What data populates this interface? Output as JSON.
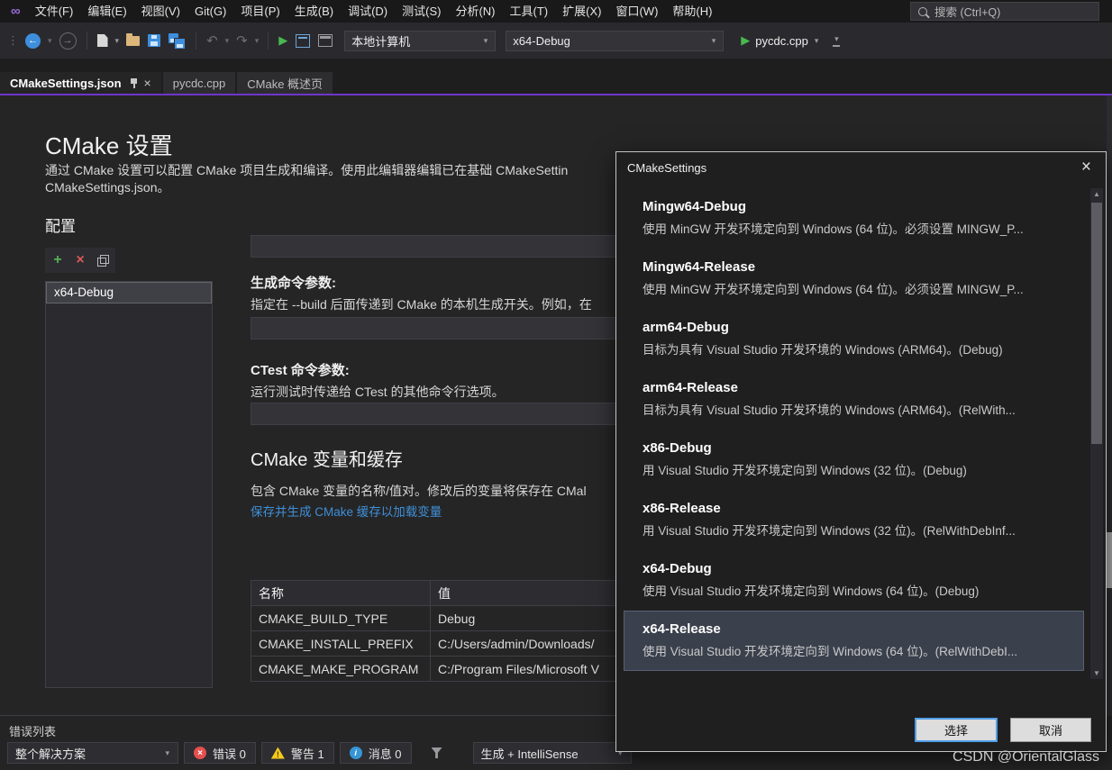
{
  "colors": {
    "accent_purple": "#6d36c9",
    "link_blue": "#3f8fd6",
    "run_green": "#49b94f",
    "error_red": "#e5504f",
    "warning_yellow": "#f2cb1d",
    "info_blue": "#3795d6",
    "editor_background": "#252526"
  },
  "icons": {
    "vs_logo": "infinity-glyph",
    "search": "magnifier",
    "back": "blue-circle-left-arrow",
    "forward": "gray-circle-right-arrow",
    "new_file": "document",
    "open_folder": "yellow-folder",
    "save": "blue-floppy",
    "save_all": "double-blue-floppy",
    "undo": "curved-left-arrow",
    "redo": "curved-right-arrow",
    "run": "green-play-triangle",
    "pin": "pushpin",
    "close": "x",
    "add": "green-plus",
    "remove": "red-x",
    "duplicate": "overlapping-squares",
    "error": "red-circle-x",
    "warning": "yellow-triangle-exclamation",
    "message": "blue-circle-i",
    "filter": "funnel",
    "dropdown_caret": "down-triangle",
    "scroll_up": "up-triangle",
    "scroll_down": "down-triangle"
  },
  "menu": {
    "items": [
      "文件(F)",
      "编辑(E)",
      "视图(V)",
      "Git(G)",
      "项目(P)",
      "生成(B)",
      "调试(D)",
      "测试(S)",
      "分析(N)",
      "工具(T)",
      "扩展(X)",
      "窗口(W)",
      "帮助(H)"
    ],
    "search_placeholder": "搜索 (Ctrl+Q)"
  },
  "toolbar": {
    "target_dropdown": "本地计算机",
    "config_dropdown": "x64-Debug",
    "startup_item": "pycdc.cpp"
  },
  "tabs": [
    {
      "label": "CMakeSettings.json",
      "active": true
    },
    {
      "label": "pycdc.cpp",
      "active": false
    },
    {
      "label": "CMake 概述页",
      "active": false
    }
  ],
  "editor": {
    "title": "CMake 设置",
    "description_line1": "通过 CMake 设置可以配置 CMake 项目生成和编译。使用此编辑器编辑已在基础 CMakeSettin",
    "description_line2": "CMakeSettings.json。",
    "config_section": {
      "title": "配置",
      "items": [
        "x64-Debug"
      ]
    },
    "cmake_args": {
      "value": ""
    },
    "build_args": {
      "label": "生成命令参数:",
      "description": "指定在 --build 后面传递到 CMake 的本机生成开关。例如，在",
      "value": ""
    },
    "ctest_args": {
      "label": "CTest 命令参数:",
      "description": "运行测试时传递给 CTest 的其他命令行选项。",
      "value": ""
    },
    "variables": {
      "title": "CMake 变量和缓存",
      "description": "包含 CMake 变量的名称/值对。修改后的变量将保存在 CMal",
      "link": "保存并生成 CMake 缓存以加载变量",
      "table": {
        "headers": [
          "名称",
          "值"
        ],
        "rows": [
          [
            "CMAKE_BUILD_TYPE",
            "Debug"
          ],
          [
            "CMAKE_INSTALL_PREFIX",
            "C:/Users/admin/Downloads/"
          ],
          [
            "CMAKE_MAKE_PROGRAM",
            "C:/Program Files/Microsoft V"
          ]
        ]
      }
    }
  },
  "dialog": {
    "title": "CMakeSettings",
    "items": [
      {
        "name": "Mingw64-Debug",
        "description": "使用 MinGW 开发环境定向到 Windows (64 位)。必须设置 MINGW_P...",
        "selected": false
      },
      {
        "name": "Mingw64-Release",
        "description": "使用 MinGW 开发环境定向到 Windows (64 位)。必须设置 MINGW_P...",
        "selected": false
      },
      {
        "name": "arm64-Debug",
        "description": "目标为具有 Visual Studio 开发环境的 Windows (ARM64)。(Debug)",
        "selected": false
      },
      {
        "name": "arm64-Release",
        "description": "目标为具有 Visual Studio 开发环境的 Windows (ARM64)。(RelWith...",
        "selected": false
      },
      {
        "name": "x86-Debug",
        "description": "用 Visual Studio 开发环境定向到 Windows (32 位)。(Debug)",
        "selected": false
      },
      {
        "name": "x86-Release",
        "description": "用 Visual Studio 开发环境定向到 Windows (32 位)。(RelWithDebInf...",
        "selected": false
      },
      {
        "name": "x64-Debug",
        "description": "使用 Visual Studio 开发环境定向到 Windows (64 位)。(Debug)",
        "selected": false
      },
      {
        "name": "x64-Release",
        "description": "使用 Visual Studio 开发环境定向到 Windows (64 位)。(RelWithDebI...",
        "selected": true
      }
    ],
    "select_button": "选择",
    "cancel_button": "取消"
  },
  "bottom_panel": {
    "title": "错误列表",
    "scope_dropdown": "整个解决方案",
    "errors_label": "错误 0",
    "warnings_label": "警告 1",
    "messages_label": "消息 0",
    "filter_dropdown": "生成 + IntelliSense"
  },
  "watermark": "CSDN @OrientalGlass"
}
